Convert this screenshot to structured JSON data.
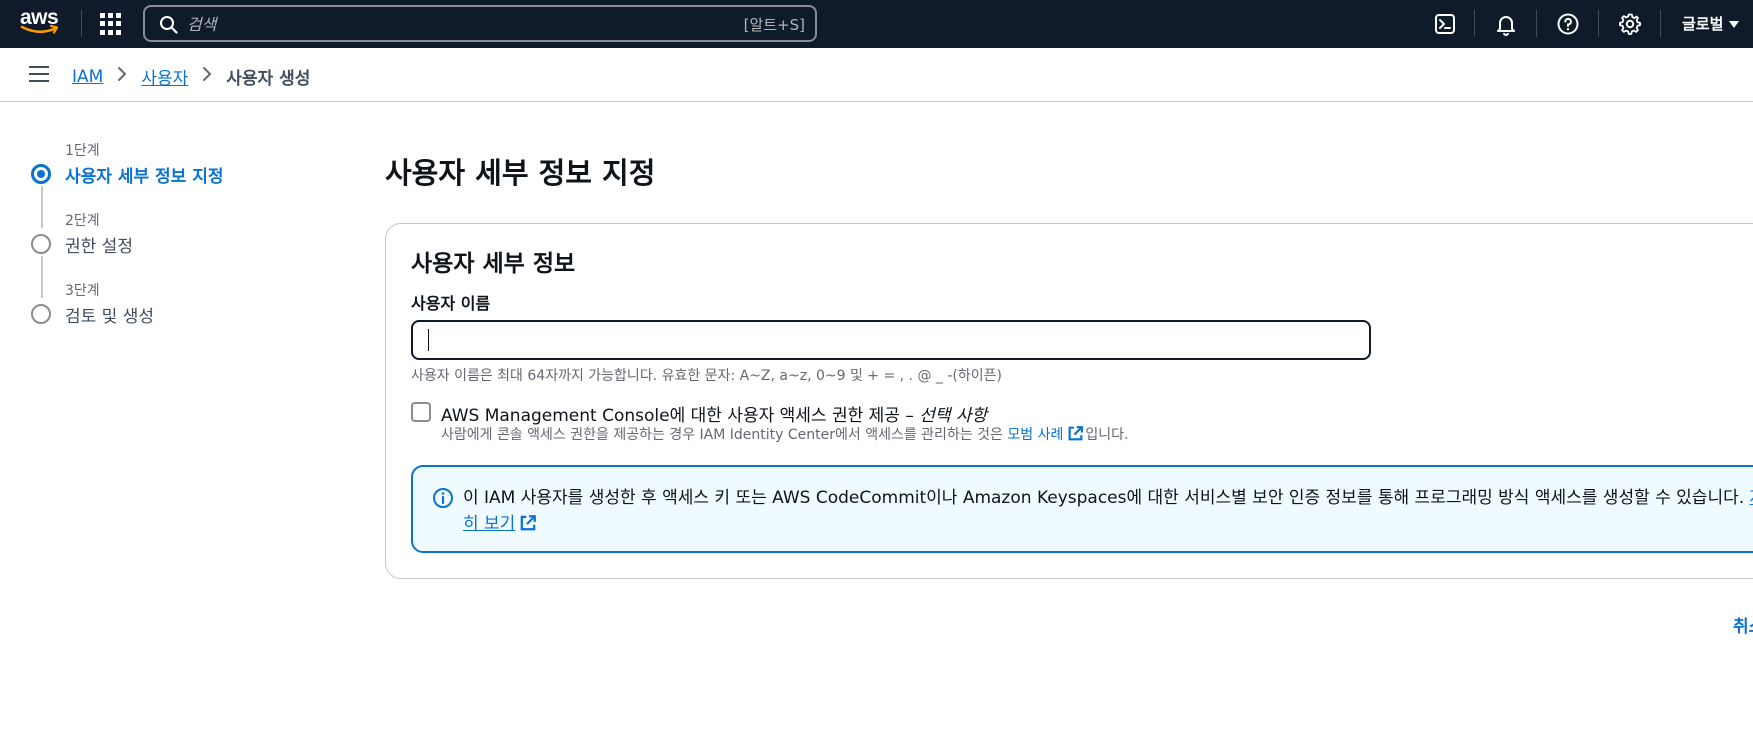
{
  "topnav": {
    "logo_text": "aws",
    "search_placeholder": "검색",
    "search_shortcut": "[알트+S]",
    "icons": [
      "cloudshell-icon",
      "bell-icon",
      "help-icon",
      "gear-icon"
    ],
    "region": "글로벌"
  },
  "breadcrumb": {
    "items": [
      "IAM",
      "사용자"
    ],
    "current": "사용자 생성"
  },
  "steps": [
    {
      "num": "1단계",
      "label": "사용자 세부 정보 지정",
      "active": true
    },
    {
      "num": "2단계",
      "label": "권한 설정",
      "active": false
    },
    {
      "num": "3단계",
      "label": "검토 및 생성",
      "active": false
    }
  ],
  "main": {
    "page_title": "사용자 세부 정보 지정",
    "section_title": "사용자 세부 정보",
    "username_label": "사용자 이름",
    "username_value": "",
    "username_constraint": "사용자 이름은 최대 64자까지 가능합니다. 유효한 문자: A~Z, a~z, 0~9 및 + = , . @ _ -(하이픈)",
    "console_access_label": "AWS Management Console에 대한 사용자 액세스 권한 제공 – ",
    "console_access_optional": "선택 사항",
    "console_access_desc": "사람에게 콘솔 액세스 권한을 제공하는 경우 IAM Identity Center에서 액세스를 관리하는 것은 ",
    "best_practice_link": "모범 사례",
    "console_access_desc_suffix": "입니다.",
    "info_message": "이 IAM 사용자를 생성한 후 액세스 키 또는 AWS CodeCommit이나 Amazon Keyspaces에 대한 서비스별 보안 인증 정보를 통해 프로그래밍 방식 액세스를 생성할 수 있습니다. ",
    "info_link": "자세히 보기",
    "cancel_label": "취소"
  },
  "colors": {
    "nav_bg": "#0f1b2a",
    "link": "#0972d3",
    "info_bg": "#f0fbff"
  }
}
